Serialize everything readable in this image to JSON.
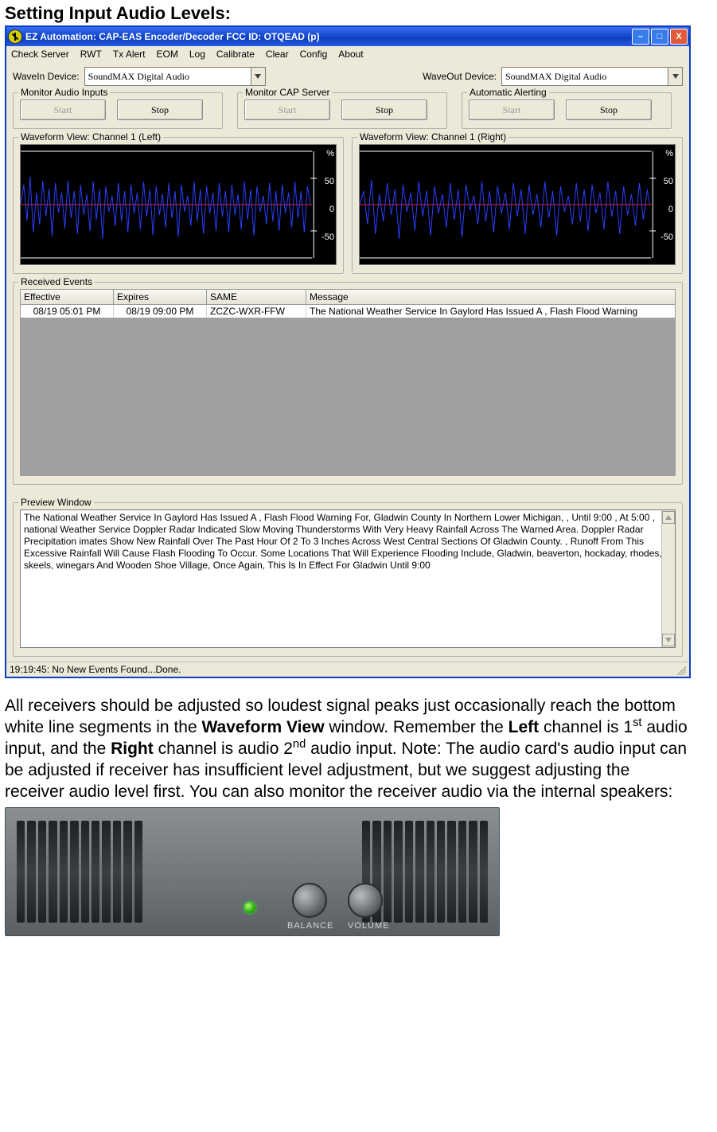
{
  "page": {
    "heading": "Setting Input Audio Levels:"
  },
  "window": {
    "title": "EZ Automation:  CAP-EAS Encoder/Decoder  FCC ID: OTQEAD (p)",
    "controls": {
      "min": "_",
      "max": "□",
      "close": "X"
    }
  },
  "menu": {
    "items": [
      "Check Server",
      "RWT",
      "Tx Alert",
      "EOM",
      "Log",
      "Calibrate",
      "Clear",
      "Config",
      "About"
    ]
  },
  "devices": {
    "wavein_label": "WaveIn Device:",
    "wavein_value": "SoundMAX Digital Audio",
    "waveout_label": "WaveOut Device:",
    "waveout_value": "SoundMAX Digital Audio"
  },
  "panels": {
    "monitor_inputs": {
      "legend": "Monitor Audio Inputs",
      "start": "Start",
      "stop": "Stop"
    },
    "monitor_cap": {
      "legend": "Monitor CAP Server",
      "start": "Start",
      "stop": "Stop"
    },
    "auto_alert": {
      "legend": "Automatic Alerting",
      "start": "Start",
      "stop": "Stop"
    }
  },
  "waveforms": {
    "left_legend": "Waveform View: Channel 1 (Left)",
    "right_legend": "Waveform View: Channel 1 (Right)",
    "scale": {
      "top": "%",
      "p50": "50",
      "zero": "0",
      "m50": "-50"
    }
  },
  "received": {
    "legend": "Received Events",
    "headers": {
      "effective": "Effective",
      "expires": "Expires",
      "same": "SAME",
      "message": "Message"
    },
    "rows": [
      {
        "effective": "08/19 05:01 PM",
        "expires": "08/19 09:00 PM",
        "same": "ZCZC-WXR-FFW",
        "message": "The National Weather Service In Gaylord Has Issued A , Flash Flood Warning"
      }
    ]
  },
  "preview": {
    "legend": "Preview Window",
    "text": "The National Weather Service In Gaylord Has Issued A , Flash Flood Warning For,  Gladwin County In Northern Lower Michigan,  , Until 9:00  , At 5:00 , national Weather Service Doppler Radar Indicated  Slow Moving Thunderstorms With Very Heavy Rainfall Across The   Warned Area. Doppler Radar Precipitation imates Show New  Rainfall Over The Past Hour Of 2 To 3 Inches Across West Central  Sections Of Gladwin County. , Runoff From This Excessive Rainfall Will Cause Flash Flooding To  Occur. Some Locations That Will Experience Flooding Include,  Gladwin, beaverton, hockaday, rhodes, skeels, winegars And  Wooden Shoe Village,  Once Again, This Is In Effect For Gladwin Until 9:00"
  },
  "statusbar": {
    "text": "19:19:45: No New Events Found...Done."
  },
  "body_text": {
    "p1a": "All receivers should be adjusted so loudest signal peaks just occasionally reach the bottom white line segments in the ",
    "p1b_bold": "Waveform View",
    "p1c": " window. Remember the ",
    "p1d_bold": "Left",
    "p1e": " channel is 1",
    "p1f_sup": "st",
    "p1g": " audio input, and the ",
    "p1h_bold": "Right",
    "p1i": " channel is audio 2",
    "p1j_sup": "nd",
    "p1k": " audio input.  Note: The audio card's audio input can be adjusted if receiver has insufficient level adjustment, but we suggest adjusting the receiver audio level first. You can also monitor the receiver audio via the internal speakers:"
  },
  "speaker": {
    "balance_label": "BALANCE",
    "volume_label": "VOLUME"
  }
}
